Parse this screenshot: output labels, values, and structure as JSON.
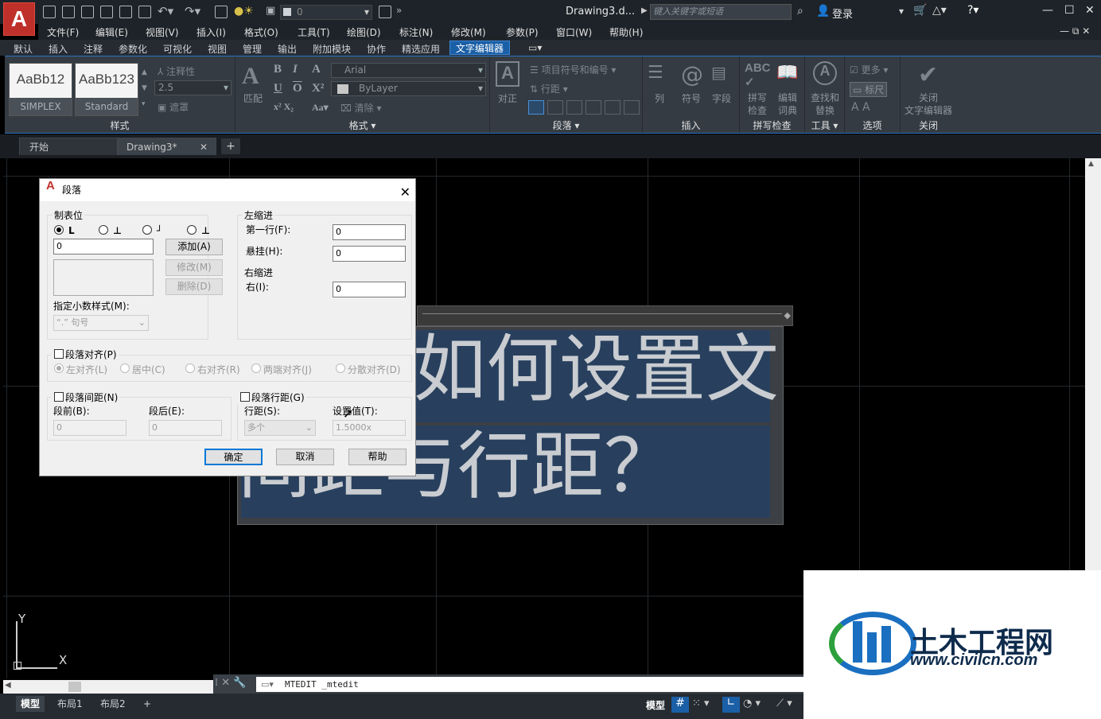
{
  "titlebar": {
    "app_logo": "A",
    "layer_value": "0",
    "document_title": "Drawing3.d...",
    "search_placeholder": "键入关键字或短语",
    "login_label": "登录"
  },
  "menubar": {
    "items": [
      "文件(F)",
      "编辑(E)",
      "视图(V)",
      "插入(I)",
      "格式(O)",
      "工具(T)",
      "绘图(D)",
      "标注(N)",
      "修改(M)",
      "参数(P)",
      "窗口(W)",
      "帮助(H)"
    ]
  },
  "ribbon_tabs": [
    "默认",
    "插入",
    "注释",
    "参数化",
    "可视化",
    "视图",
    "管理",
    "输出",
    "附加模块",
    "协作",
    "精选应用",
    "文字编辑器"
  ],
  "ribbon": {
    "style": {
      "title": "样式",
      "style1_preview": "AaBb12",
      "style1_name": "SIMPLEX",
      "style2_preview": "AaBb123",
      "style2_name": "Standard",
      "annotative_label": "注释性",
      "height_value": "2.5",
      "mask_label": "遮罩"
    },
    "format": {
      "title": "格式 ▾",
      "font_value": "Arial",
      "color_value": "ByLayer",
      "match_label": "匹配",
      "clear_label": "清除 ▾"
    },
    "paragraph": {
      "title": "段落 ▾",
      "justify_label": "对正",
      "bullets_label": "项目符号和编号 ▾",
      "line_spacing_label": "行距 ▾"
    },
    "insert": {
      "title": "插入",
      "columns_label": "列",
      "symbol_label": "符号",
      "field_label": "字段"
    },
    "spell": {
      "title": "拼写检查",
      "spell_check_label": "拼写\n检查",
      "edit_dict_label": "编辑\n词典"
    },
    "tools": {
      "title": "工具 ▾",
      "find_replace_label": "查找和\n替换"
    },
    "options": {
      "title": "选项",
      "more_label": "更多 ▾",
      "ruler_label": "标尺"
    },
    "close": {
      "title": "关闭",
      "close_editor_label": "关闭\n文字编辑器"
    }
  },
  "doc_tabs": {
    "start_label": "开始",
    "drawing_label": "Drawing3*",
    "close_glyph": "✕",
    "add_glyph": "+"
  },
  "mtext": {
    "line1": "如何设置文",
    "line2": "间距与行距？"
  },
  "dialog": {
    "title": "段落",
    "tab_group": "制表位",
    "tab_value": "0",
    "add_button": "添加(A)",
    "modify_button": "修改(M)",
    "delete_button": "删除(D)",
    "decimal_label": "指定小数样式(M):",
    "decimal_value": "“.”  句号",
    "left_indent_group": "左缩进",
    "first_line_label": "第一行(F):",
    "first_line_value": "0",
    "hanging_label": "悬挂(H):",
    "hanging_value": "0",
    "right_indent_group": "右缩进",
    "right_label": "右(I):",
    "right_value": "0",
    "alignment_label": "段落对齐(P)",
    "align_left": "左对齐(L)",
    "align_center": "居中(C)",
    "align_right": "右对齐(R)",
    "align_justify": "两端对齐(J)",
    "align_distributed": "分散对齐(D)",
    "spacing_label": "段落间距(N)",
    "before_label": "段前(B):",
    "before_value": "0",
    "after_label": "段后(E):",
    "after_value": "0",
    "line_spacing_label": "段落行距(G)",
    "line_spacing_type_label": "行距(S):",
    "line_spacing_type_value": "多个",
    "at_label": "设置值(T):",
    "at_value": "1.5000x",
    "ok_button": "确定",
    "cancel_button": "取消",
    "help_button": "帮助"
  },
  "command": {
    "text": "MTEDIT _mtedit"
  },
  "layout_tabs": [
    "模型",
    "布局1",
    "布局2"
  ],
  "status": {
    "model_label": "模型"
  },
  "ucs": {
    "x_label": "X",
    "y_label": "Y"
  },
  "watermark": {
    "title": "土木工程网",
    "url": "www.civilcn.com"
  }
}
